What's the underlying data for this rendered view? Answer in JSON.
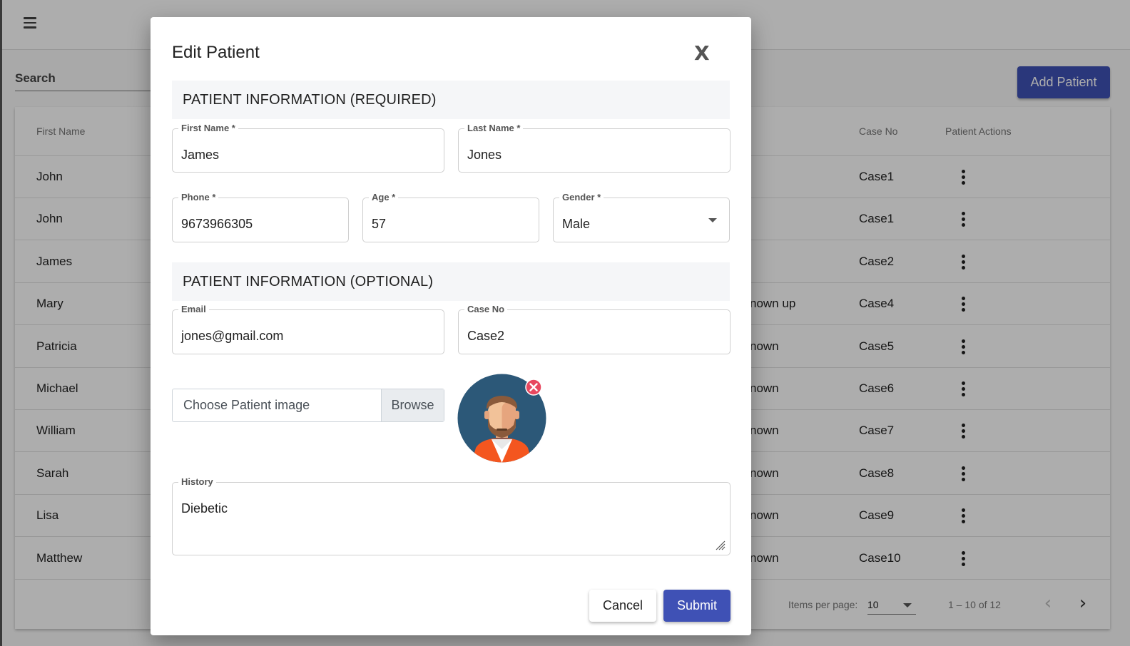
{
  "header": {
    "search_label": "Search",
    "add_patient_label": "Add Patient"
  },
  "table": {
    "columns": {
      "first_name": "First Name",
      "case_no": "Case No",
      "actions": "Patient Actions"
    },
    "rows": [
      {
        "first_name": "John",
        "partial": "",
        "case_no": "Case1"
      },
      {
        "first_name": "John",
        "partial": "",
        "case_no": "Case1"
      },
      {
        "first_name": "James",
        "partial": "",
        "case_no": "Case2"
      },
      {
        "first_name": "Mary",
        "partial": "nown up",
        "case_no": "Case4"
      },
      {
        "first_name": "Patricia",
        "partial": "nown",
        "case_no": "Case5"
      },
      {
        "first_name": "Michael",
        "partial": "nown",
        "case_no": "Case6"
      },
      {
        "first_name": "William",
        "partial": "nown",
        "case_no": "Case7"
      },
      {
        "first_name": "Sarah",
        "partial": "nown",
        "case_no": "Case8"
      },
      {
        "first_name": "Lisa",
        "partial": "nown",
        "case_no": "Case9"
      },
      {
        "first_name": "Matthew",
        "partial": "nown",
        "case_no": "Case10"
      }
    ]
  },
  "paginator": {
    "items_per_page_label": "Items per page:",
    "items_per_page_value": "10",
    "range_label": "1 – 10 of 12"
  },
  "modal": {
    "title": "Edit Patient",
    "close_label": "X",
    "required_section": "PATIENT INFORMATION (REQUIRED)",
    "optional_section": "PATIENT INFORMATION (OPTIONAL)",
    "fields": {
      "first_name": {
        "label": "First Name *",
        "value": "James"
      },
      "last_name": {
        "label": "Last Name *",
        "value": "Jones"
      },
      "phone": {
        "label": "Phone *",
        "value": "9673966305"
      },
      "age": {
        "label": "Age *",
        "value": "57"
      },
      "gender": {
        "label": "Gender *",
        "value": "Male"
      },
      "email": {
        "label": "Email",
        "value": "jones@gmail.com"
      },
      "case_no": {
        "label": "Case No",
        "value": "Case2"
      },
      "history": {
        "label": "History",
        "value": "Diebetic"
      }
    },
    "image_placeholder": "Choose Patient image",
    "browse_label": "Browse",
    "cancel_label": "Cancel",
    "submit_label": "Submit"
  },
  "colors": {
    "primary": "#3f51b5",
    "avatar_bg": "#2c5878",
    "avatar_jacket": "#f4561f",
    "remove_badge": "#e8475f"
  }
}
